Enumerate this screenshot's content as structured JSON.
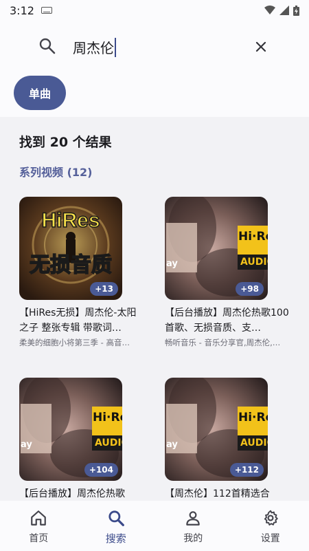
{
  "status": {
    "time": "3:12"
  },
  "search": {
    "query": "周杰伦"
  },
  "filter_chip": {
    "label": "单曲"
  },
  "results": {
    "summary": "找到 20 个结果",
    "section_title": "系列视频 (12)"
  },
  "cards": [
    {
      "thumb_style": "hires",
      "thumb_top_text": "HiRes",
      "thumb_bottom_text": "无损音质",
      "badge": "+13",
      "title": "【HiRes无损】周杰伦-太阳之子 整张专辑 带歌词…",
      "subtitle": "柔美的细胞小将第三季 - 高音…"
    },
    {
      "thumb_style": "blur",
      "thumb_logo_text": "Hi·Res",
      "thumb_logo_sub": "AUDIO",
      "thumb_side_text": "ay",
      "badge": "+98",
      "title": "【后台播放】周杰伦热歌100首歌、无损音质、支…",
      "subtitle": "畅听音乐 - 音乐分享官,周杰伦,…"
    },
    {
      "thumb_style": "blur",
      "thumb_logo_text": "Hi·Res",
      "thumb_logo_sub": "AUDIO",
      "thumb_side_text": "ay",
      "badge": "+104",
      "title": "【后台播放】周杰伦热歌",
      "subtitle": ""
    },
    {
      "thumb_style": "blur",
      "thumb_logo_text": "Hi·Res",
      "thumb_logo_sub": "AUDIO",
      "thumb_side_text": "ay",
      "badge": "+112",
      "title": "【周杰伦】112首精选合",
      "subtitle": ""
    }
  ],
  "nav": [
    {
      "label": "首页",
      "icon": "home-icon"
    },
    {
      "label": "搜索",
      "icon": "search-icon",
      "active": true
    },
    {
      "label": "我的",
      "icon": "person-icon"
    },
    {
      "label": "设置",
      "icon": "gear-icon"
    }
  ],
  "colors": {
    "accent": "#4a5a95",
    "section": "#55609a",
    "hires_gold": "#f7e04a"
  }
}
